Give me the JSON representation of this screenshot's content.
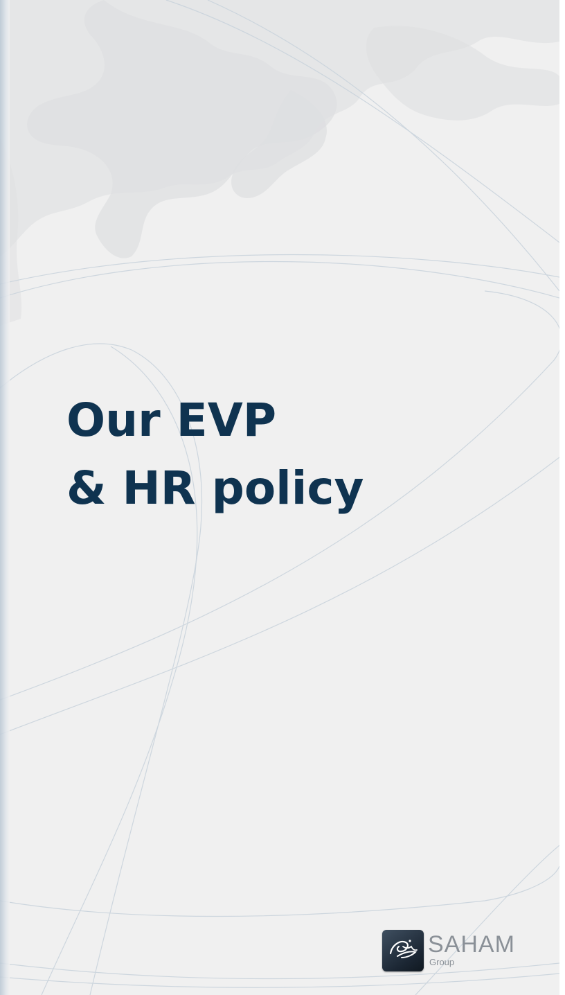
{
  "title": {
    "line1": "Our EVP",
    "line2": "& HR policy"
  },
  "logo": {
    "wordmark": "SAHAM",
    "subtitle": "Group",
    "icon": "saham-logo-icon"
  },
  "colors": {
    "title": "#0f3350",
    "background": "#f0f0f0",
    "logo_text": "#8a9097"
  }
}
